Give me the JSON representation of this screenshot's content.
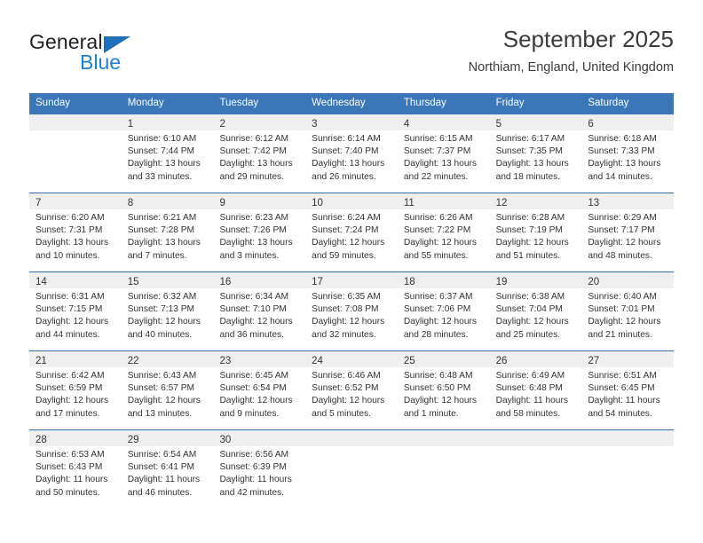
{
  "brand": {
    "name_top": "General",
    "name_bottom": "Blue",
    "accent_color": "#1d6fb8",
    "accent_color_light": "#1c7fd4"
  },
  "header": {
    "title": "September 2025",
    "subtitle": "Northiam, England, United Kingdom"
  },
  "theme": {
    "header_bg": "#3a76b8",
    "header_text": "#ffffff",
    "daynum_band_bg": "#efefef",
    "row_divider": "#2f6ca8",
    "body_text": "#333333"
  },
  "weekdays": [
    "Sunday",
    "Monday",
    "Tuesday",
    "Wednesday",
    "Thursday",
    "Friday",
    "Saturday"
  ],
  "weeks": [
    [
      {
        "day": "",
        "lines": []
      },
      {
        "day": "1",
        "lines": [
          "Sunrise: 6:10 AM",
          "Sunset: 7:44 PM",
          "Daylight: 13 hours",
          "and 33 minutes."
        ]
      },
      {
        "day": "2",
        "lines": [
          "Sunrise: 6:12 AM",
          "Sunset: 7:42 PM",
          "Daylight: 13 hours",
          "and 29 minutes."
        ]
      },
      {
        "day": "3",
        "lines": [
          "Sunrise: 6:14 AM",
          "Sunset: 7:40 PM",
          "Daylight: 13 hours",
          "and 26 minutes."
        ]
      },
      {
        "day": "4",
        "lines": [
          "Sunrise: 6:15 AM",
          "Sunset: 7:37 PM",
          "Daylight: 13 hours",
          "and 22 minutes."
        ]
      },
      {
        "day": "5",
        "lines": [
          "Sunrise: 6:17 AM",
          "Sunset: 7:35 PM",
          "Daylight: 13 hours",
          "and 18 minutes."
        ]
      },
      {
        "day": "6",
        "lines": [
          "Sunrise: 6:18 AM",
          "Sunset: 7:33 PM",
          "Daylight: 13 hours",
          "and 14 minutes."
        ]
      }
    ],
    [
      {
        "day": "7",
        "lines": [
          "Sunrise: 6:20 AM",
          "Sunset: 7:31 PM",
          "Daylight: 13 hours",
          "and 10 minutes."
        ]
      },
      {
        "day": "8",
        "lines": [
          "Sunrise: 6:21 AM",
          "Sunset: 7:28 PM",
          "Daylight: 13 hours",
          "and 7 minutes."
        ]
      },
      {
        "day": "9",
        "lines": [
          "Sunrise: 6:23 AM",
          "Sunset: 7:26 PM",
          "Daylight: 13 hours",
          "and 3 minutes."
        ]
      },
      {
        "day": "10",
        "lines": [
          "Sunrise: 6:24 AM",
          "Sunset: 7:24 PM",
          "Daylight: 12 hours",
          "and 59 minutes."
        ]
      },
      {
        "day": "11",
        "lines": [
          "Sunrise: 6:26 AM",
          "Sunset: 7:22 PM",
          "Daylight: 12 hours",
          "and 55 minutes."
        ]
      },
      {
        "day": "12",
        "lines": [
          "Sunrise: 6:28 AM",
          "Sunset: 7:19 PM",
          "Daylight: 12 hours",
          "and 51 minutes."
        ]
      },
      {
        "day": "13",
        "lines": [
          "Sunrise: 6:29 AM",
          "Sunset: 7:17 PM",
          "Daylight: 12 hours",
          "and 48 minutes."
        ]
      }
    ],
    [
      {
        "day": "14",
        "lines": [
          "Sunrise: 6:31 AM",
          "Sunset: 7:15 PM",
          "Daylight: 12 hours",
          "and 44 minutes."
        ]
      },
      {
        "day": "15",
        "lines": [
          "Sunrise: 6:32 AM",
          "Sunset: 7:13 PM",
          "Daylight: 12 hours",
          "and 40 minutes."
        ]
      },
      {
        "day": "16",
        "lines": [
          "Sunrise: 6:34 AM",
          "Sunset: 7:10 PM",
          "Daylight: 12 hours",
          "and 36 minutes."
        ]
      },
      {
        "day": "17",
        "lines": [
          "Sunrise: 6:35 AM",
          "Sunset: 7:08 PM",
          "Daylight: 12 hours",
          "and 32 minutes."
        ]
      },
      {
        "day": "18",
        "lines": [
          "Sunrise: 6:37 AM",
          "Sunset: 7:06 PM",
          "Daylight: 12 hours",
          "and 28 minutes."
        ]
      },
      {
        "day": "19",
        "lines": [
          "Sunrise: 6:38 AM",
          "Sunset: 7:04 PM",
          "Daylight: 12 hours",
          "and 25 minutes."
        ]
      },
      {
        "day": "20",
        "lines": [
          "Sunrise: 6:40 AM",
          "Sunset: 7:01 PM",
          "Daylight: 12 hours",
          "and 21 minutes."
        ]
      }
    ],
    [
      {
        "day": "21",
        "lines": [
          "Sunrise: 6:42 AM",
          "Sunset: 6:59 PM",
          "Daylight: 12 hours",
          "and 17 minutes."
        ]
      },
      {
        "day": "22",
        "lines": [
          "Sunrise: 6:43 AM",
          "Sunset: 6:57 PM",
          "Daylight: 12 hours",
          "and 13 minutes."
        ]
      },
      {
        "day": "23",
        "lines": [
          "Sunrise: 6:45 AM",
          "Sunset: 6:54 PM",
          "Daylight: 12 hours",
          "and 9 minutes."
        ]
      },
      {
        "day": "24",
        "lines": [
          "Sunrise: 6:46 AM",
          "Sunset: 6:52 PM",
          "Daylight: 12 hours",
          "and 5 minutes."
        ]
      },
      {
        "day": "25",
        "lines": [
          "Sunrise: 6:48 AM",
          "Sunset: 6:50 PM",
          "Daylight: 12 hours",
          "and 1 minute."
        ]
      },
      {
        "day": "26",
        "lines": [
          "Sunrise: 6:49 AM",
          "Sunset: 6:48 PM",
          "Daylight: 11 hours",
          "and 58 minutes."
        ]
      },
      {
        "day": "27",
        "lines": [
          "Sunrise: 6:51 AM",
          "Sunset: 6:45 PM",
          "Daylight: 11 hours",
          "and 54 minutes."
        ]
      }
    ],
    [
      {
        "day": "28",
        "lines": [
          "Sunrise: 6:53 AM",
          "Sunset: 6:43 PM",
          "Daylight: 11 hours",
          "and 50 minutes."
        ]
      },
      {
        "day": "29",
        "lines": [
          "Sunrise: 6:54 AM",
          "Sunset: 6:41 PM",
          "Daylight: 11 hours",
          "and 46 minutes."
        ]
      },
      {
        "day": "30",
        "lines": [
          "Sunrise: 6:56 AM",
          "Sunset: 6:39 PM",
          "Daylight: 11 hours",
          "and 42 minutes."
        ]
      },
      {
        "day": "",
        "lines": []
      },
      {
        "day": "",
        "lines": []
      },
      {
        "day": "",
        "lines": []
      },
      {
        "day": "",
        "lines": []
      }
    ]
  ]
}
